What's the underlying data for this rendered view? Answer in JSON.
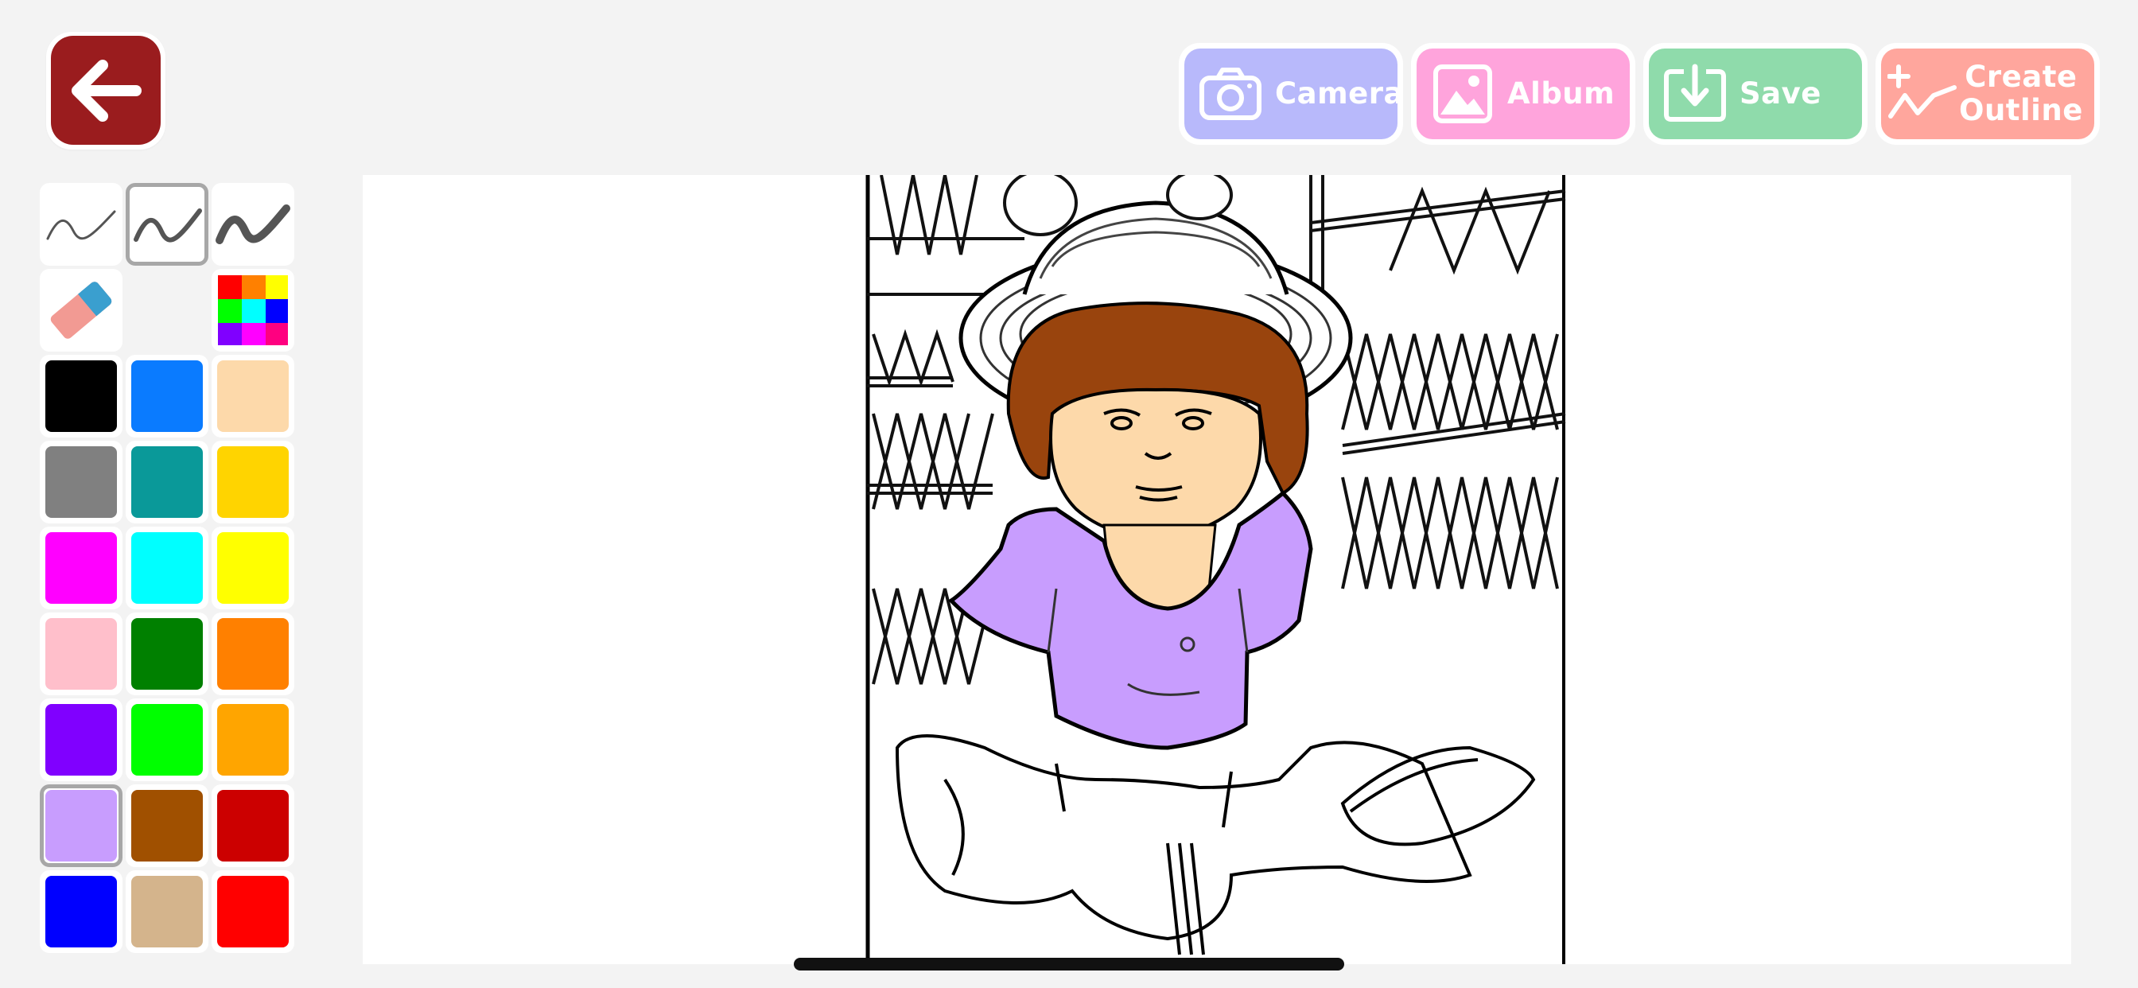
{
  "toolbar": {
    "back_label": "",
    "buttons": [
      {
        "id": "camera",
        "label": "Camera",
        "color": "#b8b9fb",
        "icon": "camera-icon"
      },
      {
        "id": "album",
        "label": "Album",
        "color": "#ffa4dc",
        "icon": "image-icon"
      },
      {
        "id": "save",
        "label": "Save",
        "color": "#8fdbab",
        "icon": "download-icon"
      },
      {
        "id": "outline",
        "label": "Create\nOutline",
        "color": "#ffa69d",
        "icon": "create-outline-icon"
      }
    ]
  },
  "tools": {
    "brush_sizes": [
      "thin",
      "medium",
      "thick"
    ],
    "selected_brush": "medium",
    "eraser_icon": "eraser-icon",
    "color_picker_icon": "color-grid-icon"
  },
  "colors": [
    "#000000",
    "#0a7bff",
    "#fdd9aa",
    "#808080",
    "#0a9999",
    "#ffd400",
    "#ff00ff",
    "#00ffff",
    "#ffff00",
    "#ffbfcb",
    "#008000",
    "#ff8000",
    "#8000ff",
    "#00ff00",
    "#ffa500",
    "#c89dfe",
    "#a05000",
    "#cc0000",
    "#0000ff",
    "#d4b48c",
    "#ff0000"
  ],
  "selected_color": "#c89dfe",
  "canvas": {
    "hair_color": "#99440d",
    "skin_color": "#fdd9aa",
    "shirt_color": "#c89dfe"
  }
}
